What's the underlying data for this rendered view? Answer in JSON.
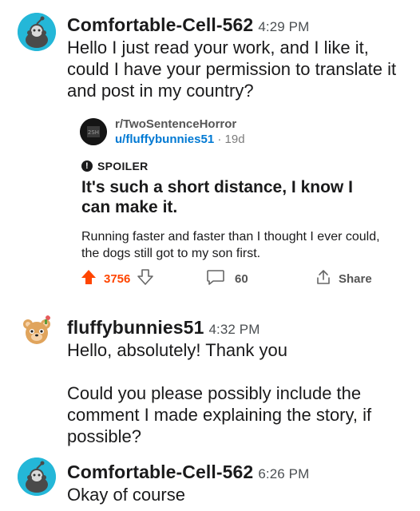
{
  "messages": [
    {
      "author": "Comfortable-Cell-562",
      "time": "4:29 PM",
      "text": "Hello I just read your work, and I like it, could I have your permission to translate it and post in my country?"
    },
    {
      "author": "fluffybunnies51",
      "time": "4:32 PM",
      "text": "Hello, absolutely! Thank you",
      "text2": "Could you please possibly include the comment I made explaining the story, if possible?"
    },
    {
      "author": "Comfortable-Cell-562",
      "time": "6:26 PM",
      "text": "Okay of course"
    }
  ],
  "shared_post": {
    "subreddit": "r/TwoSentenceHorror",
    "user": "u/fluffybunnies51",
    "age": "19d",
    "spoiler_label": "SPOILER",
    "title": "It's such a short distance, I know I can make it.",
    "body": "Running faster and faster than I thought I ever could, the dogs still got to my son first.",
    "votes": "3756",
    "comments": "60",
    "share_label": "Share"
  },
  "colors": {
    "upvote": "#ff4500",
    "snoo_avatar": "#24b7d8",
    "link": "#0079d3"
  },
  "icons": [
    "snoo-avatar-icon",
    "bear-avatar-icon",
    "spoiler-icon",
    "upvote-icon",
    "downvote-icon",
    "comment-icon",
    "share-icon"
  ]
}
